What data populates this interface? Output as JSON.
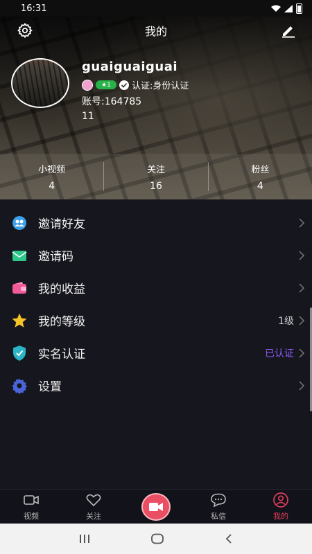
{
  "status_bar": {
    "time": "16:31"
  },
  "header": {
    "title": "我的"
  },
  "profile": {
    "username": "guaiguaiguai",
    "badge_level": "1",
    "verification": "认证:身份认证",
    "account": "账号:164785",
    "extra_line": "11"
  },
  "stats": [
    {
      "label": "小视频",
      "value": "4"
    },
    {
      "label": "关注",
      "value": "16"
    },
    {
      "label": "粉丝",
      "value": "4"
    }
  ],
  "menu": [
    {
      "label": "邀请好友",
      "value": "",
      "icon": "invite-friends-icon"
    },
    {
      "label": "邀请码",
      "value": "",
      "icon": "invite-code-icon"
    },
    {
      "label": "我的收益",
      "value": "",
      "icon": "wallet-icon"
    },
    {
      "label": "我的等级",
      "value": "1级",
      "icon": "star-icon"
    },
    {
      "label": "实名认证",
      "value": "已认证",
      "icon": "shield-icon"
    },
    {
      "label": "设置",
      "value": "",
      "icon": "gear-icon"
    }
  ],
  "bottom_nav": [
    {
      "label": "视频",
      "icon": "video-icon"
    },
    {
      "label": "关注",
      "icon": "heart-icon"
    },
    {
      "label": "",
      "icon": "camera-icon"
    },
    {
      "label": "私信",
      "icon": "message-icon"
    },
    {
      "label": "我的",
      "icon": "user-icon"
    }
  ],
  "colors": {
    "accent": "#e94e63",
    "verified": "#8a5cf6",
    "background": "#16161e"
  }
}
